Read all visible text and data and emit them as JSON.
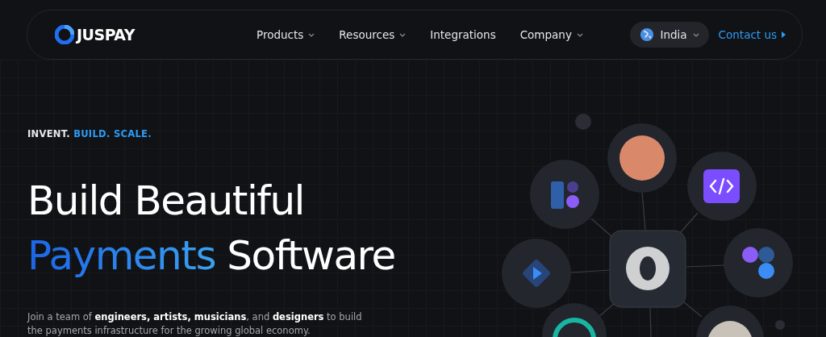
{
  "header": {
    "logo": "JUSPAY",
    "nav": [
      {
        "label": "Products",
        "dropdown": true
      },
      {
        "label": "Resources",
        "dropdown": true
      },
      {
        "label": "Integrations",
        "dropdown": false
      },
      {
        "label": "Company",
        "dropdown": true
      }
    ],
    "region": {
      "label": "India"
    },
    "contact": {
      "label": "Contact us"
    }
  },
  "hero": {
    "eyebrow": {
      "lead": "INVENT.",
      "accent": "BUILD. SCALE."
    },
    "headline": {
      "line_1": "Build Beautiful",
      "accent": "Payments",
      "rest": "Software"
    },
    "description": "Join a team of **engineers, artists, musicians**, and **designers** to build the payments infrastructure for the growing global economy."
  }
}
